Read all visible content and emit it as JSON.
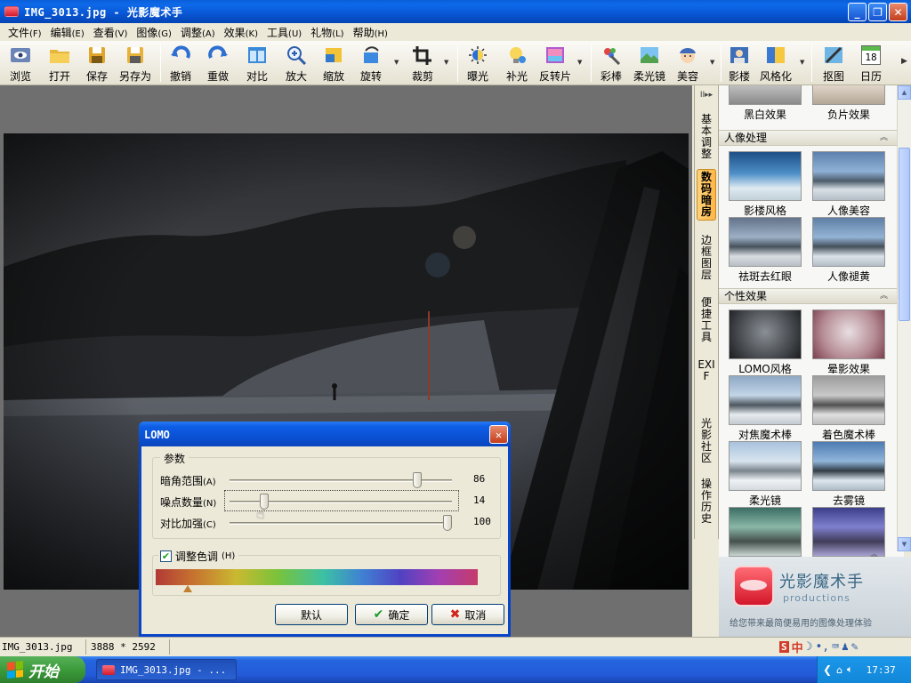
{
  "window": {
    "title": "IMG_3013.jpg - 光影魔术手"
  },
  "menu": [
    {
      "label": "文件",
      "key": "(F)"
    },
    {
      "label": "编辑",
      "key": "(E)"
    },
    {
      "label": "查看",
      "key": "(V)"
    },
    {
      "label": "图像",
      "key": "(G)"
    },
    {
      "label": "调整",
      "key": "(A)"
    },
    {
      "label": "效果",
      "key": "(K)"
    },
    {
      "label": "工具",
      "key": "(U)"
    },
    {
      "label": "礼物",
      "key": "(L)"
    },
    {
      "label": "帮助",
      "key": "(H)"
    }
  ],
  "toolbar": {
    "browse": "浏览",
    "open": "打开",
    "save": "保存",
    "save_as": "另存为",
    "undo": "撤销",
    "redo": "重做",
    "compare": "对比",
    "zoom": "放大",
    "resize": "缩放",
    "rotate": "旋转",
    "crop": "裁剪",
    "exposure": "曝光",
    "fill_light": "补光",
    "reverse": "反转片",
    "magic": "彩棒",
    "soft": "柔光镜",
    "beauty": "美容",
    "studio": "影楼",
    "stylize": "风格化",
    "cutout": "抠图",
    "calendar": "日历",
    "calendar_day": "18"
  },
  "side_tabs": [
    "基本调整",
    "数码暗房",
    "边框图层",
    "便捷工具",
    "EXIF",
    "光影社区",
    "操作历史"
  ],
  "effects": {
    "top_row": [
      "黑白效果",
      "负片效果"
    ],
    "portrait": {
      "title": "人像处理",
      "items": [
        "影楼风格",
        "人像美容",
        "祛斑去红眼",
        "人像褪黄"
      ]
    },
    "personal": {
      "title": "个性效果",
      "items": [
        "LOMO风格",
        "晕影效果",
        "对焦魔术棒",
        "着色魔术棒",
        "柔光镜",
        "去雾镜"
      ]
    }
  },
  "banner": {
    "name": "光影魔术手",
    "sub": "productions",
    "slogan": "给您带来最简便易用的图像处理体验"
  },
  "status": {
    "filename": "IMG_3013.jpg",
    "dimensions": "3888 * 2592",
    "ime_lang": "中"
  },
  "taskbar": {
    "start": "开始",
    "task": "IMG_3013.jpg - ...",
    "clock": "17:37"
  },
  "dialog": {
    "title": "LOMO",
    "group_title": "参数",
    "sliders": [
      {
        "label": "暗角范围",
        "key": "(A)",
        "value": "86",
        "fraction": 0.86
      },
      {
        "label": "噪点数量",
        "key": "(N)",
        "value": "14",
        "fraction": 0.14
      },
      {
        "label": "对比加强",
        "key": "(C)",
        "value": "100",
        "fraction": 1.0
      }
    ],
    "hue_checkbox": "调整色调",
    "hue_key": "(H)",
    "hue_checked": true,
    "hue_position": 0.1,
    "buttons": {
      "default": "默认",
      "ok": "确定",
      "cancel": "取消"
    }
  }
}
